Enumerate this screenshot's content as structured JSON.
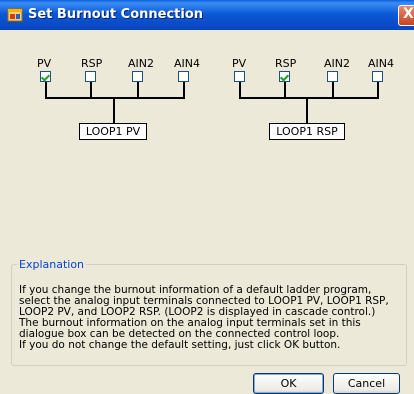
{
  "window": {
    "title": "Set Burnout Connection",
    "close_glyph": "X",
    "icon": "app-window-icon"
  },
  "loop1_pv": {
    "labels": [
      "PV",
      "RSP",
      "AIN2",
      "AIN4"
    ],
    "checked": [
      true,
      false,
      false,
      false
    ],
    "box_label": "LOOP1 PV"
  },
  "loop1_rsp": {
    "labels": [
      "PV",
      "RSP",
      "AIN2",
      "AIN4"
    ],
    "checked": [
      false,
      true,
      false,
      false
    ],
    "box_label": "LOOP1 RSP"
  },
  "explanation": {
    "legend": "Explanation",
    "lines": [
      "If you change the burnout information of a default ladder program, select the analog input terminals connected to LOOP1 PV, LOOP1 RSP, LOOP2 PV, and LOOP2 RSP. (LOOP2 is displayed in cascade control.)",
      "The burnout information on the analog input terminals set in this dialogue box can be detected on the connected control loop.",
      "If you do not change the default setting, just click OK button."
    ]
  },
  "buttons": {
    "ok": "OK",
    "cancel": "Cancel"
  },
  "colors": {
    "titlebar": "#0a5ad8",
    "dialog_bg": "#ece9d8",
    "legend": "#0046d5",
    "check": "#21a121"
  }
}
